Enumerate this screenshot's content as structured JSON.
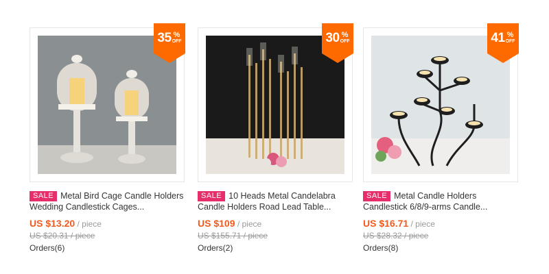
{
  "products": [
    {
      "discount": "35",
      "pct": "%",
      "off": "OFF",
      "sale": "SALE",
      "title": "Metal Bird Cage Candle Holders Wedding Candlestick Cages...",
      "price": "US $13.20",
      "unit": " / piece",
      "old_price": "US $20.31 / piece",
      "orders": "Orders(6)",
      "image": "bird-cage-candle-holders"
    },
    {
      "discount": "30",
      "pct": "%",
      "off": "OFF",
      "sale": "SALE",
      "title": "10 Heads Metal Candelabra Candle Holders Road Lead Table...",
      "price": "US $109",
      "unit": " / piece",
      "old_price": "US $155.71 / piece",
      "orders": "Orders(2)",
      "image": "gold-candelabra"
    },
    {
      "discount": "41",
      "pct": "%",
      "off": "OFF",
      "sale": "SALE",
      "title": "Metal Candle Holders Candlestick 6/8/9-arms Candle...",
      "price": "US $16.71",
      "unit": " / piece",
      "old_price": "US $28.32 / piece",
      "orders": "Orders(8)",
      "image": "black-tealight-tree"
    }
  ],
  "colors": {
    "badge": "#ff6a00",
    "sale": "#e62e6b",
    "price": "#f05a1f"
  }
}
